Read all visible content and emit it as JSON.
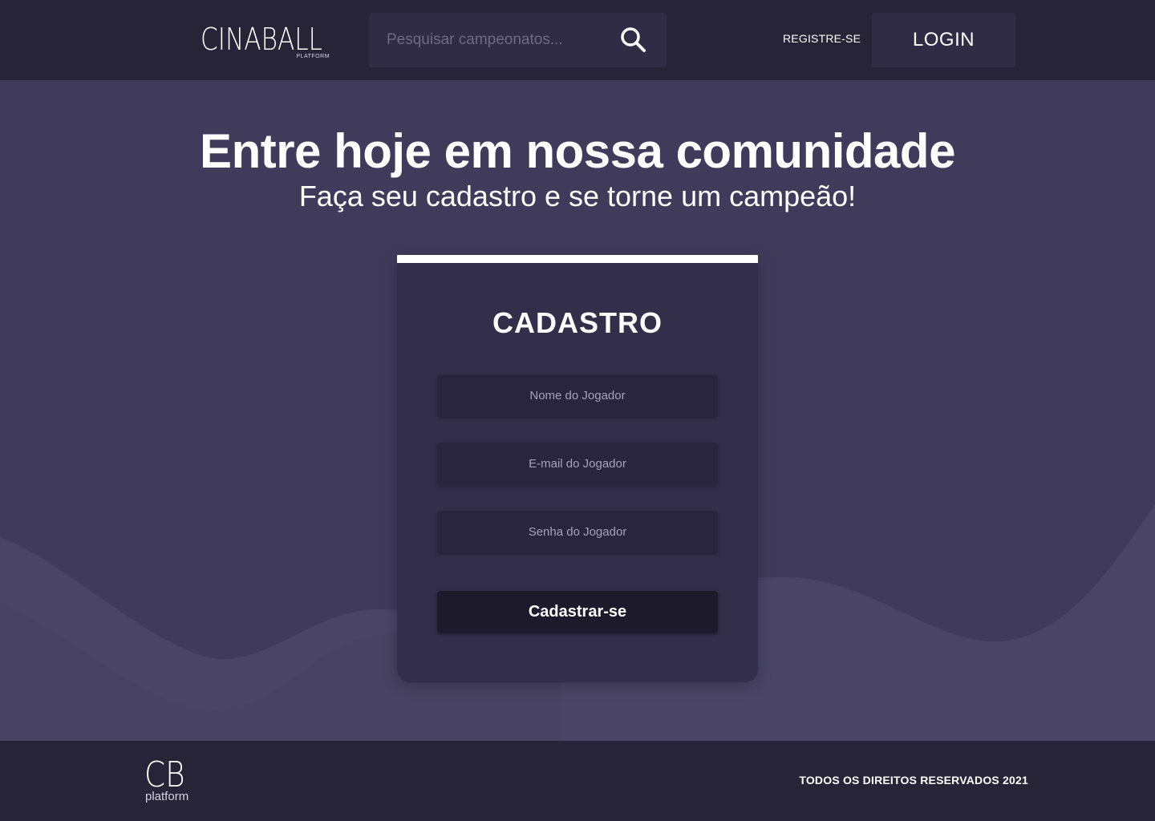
{
  "header": {
    "logo_main": "CINABALL",
    "logo_sub": "PLATFORM",
    "search_placeholder": "Pesquisar campeonatos...",
    "register_label": "REGISTRE-SE",
    "login_label": "LOGIN"
  },
  "hero": {
    "title": "Entre hoje em nossa comunidade",
    "subtitle": "Faça seu cadastro e se torne um campeão!"
  },
  "form": {
    "title": "CADASTRO",
    "name_placeholder": "Nome do Jogador",
    "email_placeholder": "E-mail do Jogador",
    "password_placeholder": "Senha do Jogador",
    "submit_label": "Cadastrar-se"
  },
  "footer": {
    "logo_main": "CB",
    "logo_sub": "platform",
    "copyright": "TODOS OS DIREITOS RESERVADOS 2021"
  },
  "colors": {
    "header_bg": "#272438",
    "page_bg": "#403b5b",
    "card_bg": "#332f4a",
    "input_bg": "#29253c",
    "submit_bg": "#1d1a2c",
    "accent": "#ffffff"
  },
  "icons": {
    "search": "search-icon"
  }
}
